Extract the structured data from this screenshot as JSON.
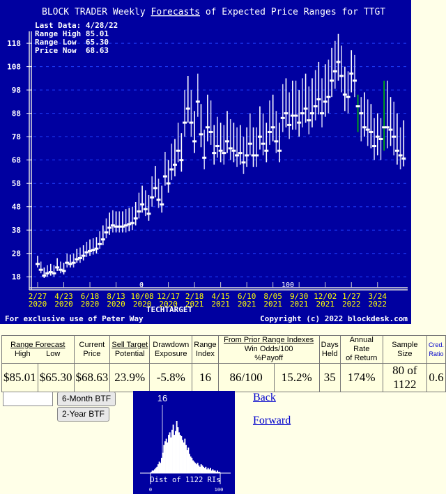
{
  "chart_data": {
    "type": "range-bar",
    "title_prefix": "BLOCK TRADER Weekly ",
    "title_link": "Forecasts",
    "title_suffix": " of Expected Price Ranges for TTGT",
    "info": [
      "Last Data: 4/28/22",
      "Range High 85.01",
      "Range Low  65.30",
      "Price Now  68.63"
    ],
    "ylim": [
      13,
      124
    ],
    "yticks": [
      18,
      28,
      38,
      48,
      58,
      68,
      78,
      88,
      98,
      108,
      118
    ],
    "grid": true,
    "xticks": [
      [
        "2/27",
        "2020"
      ],
      [
        "4/23",
        "2020"
      ],
      [
        "6/18",
        "2020"
      ],
      [
        "8/13",
        "2020"
      ],
      [
        "10/08",
        "2020"
      ],
      [
        "12/17",
        "2020"
      ],
      [
        "2/18",
        "2021"
      ],
      [
        "4/15",
        "2021"
      ],
      [
        "6/10",
        "2021"
      ],
      [
        "8/05",
        "2021"
      ],
      [
        "9/30",
        "2021"
      ],
      [
        "12/02",
        "2021"
      ],
      [
        "1/27",
        "2022"
      ],
      [
        "3/24",
        "2022"
      ]
    ],
    "xlabel": "TECHTARGET",
    "ri_scale_labels": [
      "0",
      "100"
    ],
    "footer_left": "For exclusive use of Peter Way",
    "footer_right": "Copyright (c) 2022 blockdesk.com",
    "colors": {
      "background": "#0000A0",
      "bar": "#FFFFFF",
      "highlight_bar": "#00C000",
      "tick_label": "#FFFF00",
      "grid": "#2040FF"
    },
    "highlight_indices": [
      98,
      106
    ],
    "weeks": [
      [
        22,
        27,
        23.5
      ],
      [
        19.5,
        24.5,
        21
      ],
      [
        17.5,
        22,
        18.5
      ],
      [
        18,
        23,
        19.5
      ],
      [
        18.5,
        23.5,
        20
      ],
      [
        18,
        23,
        19.5
      ],
      [
        20.5,
        26,
        22
      ],
      [
        19.5,
        24.5,
        21
      ],
      [
        19,
        24,
        20.5
      ],
      [
        22,
        28,
        24
      ],
      [
        22,
        27.5,
        23.5
      ],
      [
        22,
        28,
        24
      ],
      [
        24,
        30,
        25.5
      ],
      [
        24,
        30.5,
        26
      ],
      [
        25,
        31.5,
        27
      ],
      [
        26.5,
        33,
        28.5
      ],
      [
        27,
        34,
        29
      ],
      [
        27.5,
        34.5,
        29.5
      ],
      [
        28,
        35,
        30
      ],
      [
        30,
        37.5,
        32
      ],
      [
        31.5,
        40,
        34
      ],
      [
        34.5,
        43,
        37
      ],
      [
        36,
        45.5,
        39
      ],
      [
        37,
        46.5,
        40
      ],
      [
        37,
        46,
        39.5
      ],
      [
        37,
        46,
        39.5
      ],
      [
        37,
        46,
        39.5
      ],
      [
        37,
        47,
        40
      ],
      [
        37.5,
        47.5,
        40.5
      ],
      [
        38,
        48,
        41
      ],
      [
        40,
        50,
        43
      ],
      [
        43,
        54,
        46
      ],
      [
        45.5,
        57,
        49
      ],
      [
        44,
        55,
        47
      ],
      [
        42,
        53,
        45
      ],
      [
        48,
        61,
        52
      ],
      [
        52,
        65.5,
        56
      ],
      [
        47.5,
        60,
        51
      ],
      [
        45.5,
        57,
        49
      ],
      [
        57,
        71.5,
        61
      ],
      [
        54,
        68,
        58
      ],
      [
        59.5,
        75,
        64
      ],
      [
        61,
        77,
        66
      ],
      [
        67,
        84,
        72
      ],
      [
        63,
        79.5,
        68
      ],
      [
        78,
        98,
        84
      ],
      [
        84,
        104,
        90
      ],
      [
        78,
        98,
        84
      ],
      [
        71,
        89,
        76
      ],
      [
        86.5,
        105,
        93
      ],
      [
        73.5,
        92,
        79
      ],
      [
        64,
        81,
        69
      ],
      [
        76,
        96,
        82
      ],
      [
        74.5,
        93.5,
        80
      ],
      [
        66,
        83,
        71
      ],
      [
        69,
        86.5,
        74
      ],
      [
        67,
        84,
        72
      ],
      [
        66,
        83,
        71
      ],
      [
        71,
        89,
        76
      ],
      [
        68,
        85.5,
        73
      ],
      [
        67,
        84,
        72
      ],
      [
        65,
        82,
        70
      ],
      [
        66,
        83,
        71
      ],
      [
        62,
        78,
        67
      ],
      [
        65,
        82,
        70
      ],
      [
        70,
        88,
        75
      ],
      [
        65,
        82,
        70
      ],
      [
        65,
        82,
        70
      ],
      [
        72.5,
        91,
        78
      ],
      [
        70,
        88,
        75
      ],
      [
        67,
        84,
        72
      ],
      [
        74.5,
        93.5,
        80
      ],
      [
        76,
        96,
        82
      ],
      [
        71,
        89,
        76
      ],
      [
        67,
        84,
        72
      ],
      [
        80,
        100.5,
        86
      ],
      [
        82,
        103,
        88
      ],
      [
        77,
        97,
        83
      ],
      [
        81,
        102,
        87
      ],
      [
        81,
        102,
        87
      ],
      [
        78,
        98,
        84
      ],
      [
        82,
        103,
        88
      ],
      [
        84,
        105,
        90
      ],
      [
        79,
        99.5,
        85
      ],
      [
        82,
        103,
        88
      ],
      [
        85,
        106.5,
        91
      ],
      [
        87.5,
        110,
        94
      ],
      [
        82,
        103,
        88
      ],
      [
        86.5,
        109,
        93
      ],
      [
        88,
        111,
        95
      ],
      [
        95,
        116,
        102
      ],
      [
        98.5,
        119,
        106
      ],
      [
        102,
        122,
        110
      ],
      [
        97,
        117,
        104
      ],
      [
        89,
        108,
        96
      ],
      [
        88,
        106,
        95
      ],
      [
        97,
        115,
        105
      ],
      [
        95,
        113,
        102
      ],
      [
        80,
        96,
        91
      ],
      [
        76,
        95,
        88
      ],
      [
        78,
        97,
        82
      ],
      [
        74,
        94,
        81
      ],
      [
        73,
        92,
        80
      ],
      [
        68,
        86,
        74
      ],
      [
        70,
        88,
        78
      ],
      [
        68,
        86,
        77
      ],
      [
        72,
        102,
        82
      ],
      [
        73,
        102,
        82
      ],
      [
        74,
        95,
        81
      ],
      [
        70,
        93,
        78
      ],
      [
        66,
        88,
        72
      ],
      [
        64,
        82,
        70
      ],
      [
        65.3,
        85.01,
        68.63
      ]
    ]
  },
  "table": {
    "headers": {
      "range_forecast": "Range Forecast",
      "high": "High",
      "low": "Low",
      "current_price": [
        "Current",
        "Price"
      ],
      "sell_target": "Sell Target",
      "potential": "Potential",
      "drawdown": [
        "Drawdown",
        "Exposure"
      ],
      "range_index": [
        "Range",
        "Index"
      ],
      "from_prior": "From Prior Range Indexes",
      "win_odds": "Win Odds/100",
      "payoff": "%Payoff",
      "days_held": [
        "Days",
        "Held"
      ],
      "annual_rate": [
        "Annual Rate",
        "of Return"
      ],
      "sample_size": "Sample Size",
      "cred_ratio": [
        "Cred.",
        "Ratio"
      ]
    },
    "values": {
      "high": "$85.01",
      "low": "$65.30",
      "current_price": "$68.63",
      "sell_target": "23.9%",
      "drawdown": "-5.8%",
      "range_index": "16",
      "win_odds": "86/100",
      "payoff": "15.2%",
      "days_held": "35",
      "annual_rate": "174%",
      "sample_size": "80 of 1122",
      "cred_ratio": "0.6"
    }
  },
  "controls": {
    "ri_input_value": "",
    "btn_6month": "6-Month BTF",
    "btn_2year": "2-Year BTF",
    "back": "Back",
    "forward": "Forward"
  },
  "histogram": {
    "current_ri": "16",
    "caption": "Dist of 1122 RIs",
    "axis_min": "0",
    "axis_max": "100",
    "bins": [
      1,
      2,
      2,
      3,
      4,
      5,
      7,
      9,
      8,
      12,
      16,
      22,
      25,
      27,
      24,
      30,
      32,
      28,
      34,
      38,
      30,
      33,
      41,
      36,
      32,
      30,
      29,
      26,
      24,
      27,
      22,
      18,
      20,
      15,
      13,
      12,
      10,
      9,
      8,
      7,
      8,
      6,
      5,
      7,
      6,
      5,
      4,
      5,
      3,
      4,
      3,
      4,
      2,
      3,
      2,
      2,
      1,
      2,
      1,
      1
    ]
  }
}
